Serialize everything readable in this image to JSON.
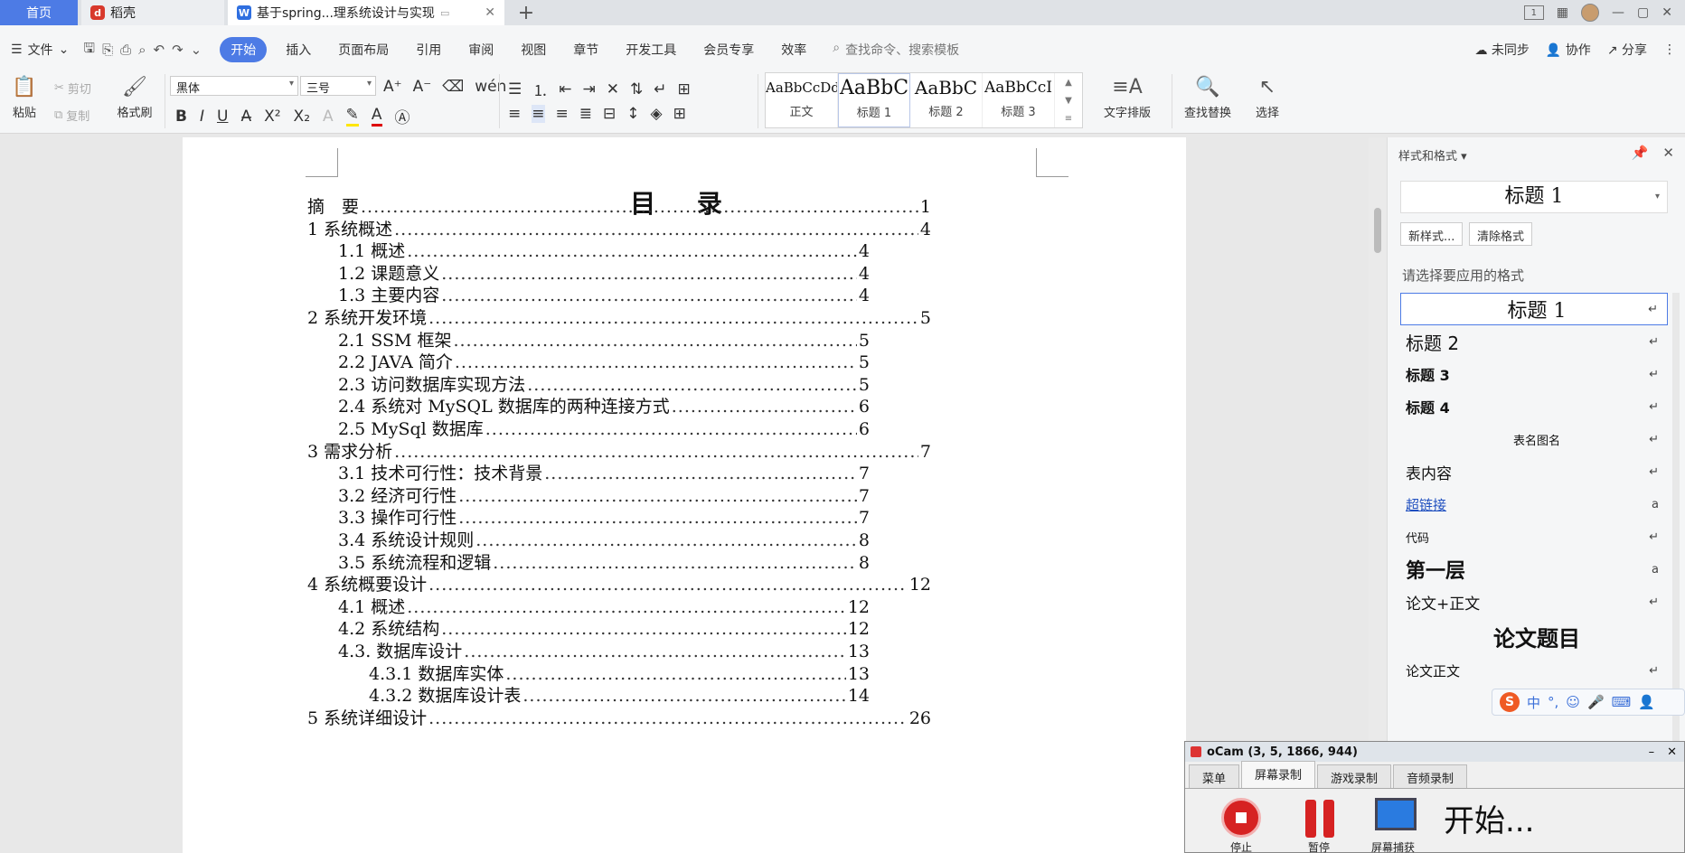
{
  "tabs": {
    "home": "首页",
    "docer": "稻壳",
    "doc": "基于spring...理系统设计与实现"
  },
  "window": {
    "page_indicator": "1"
  },
  "menu": {
    "file": "文件",
    "items": [
      "开始",
      "插入",
      "页面布局",
      "引用",
      "审阅",
      "视图",
      "章节",
      "开发工具",
      "会员专享",
      "效率"
    ],
    "search_placeholder": "查找命令、搜索模板",
    "sync": "未同步",
    "collab": "协作",
    "share": "分享"
  },
  "ribbon": {
    "paste": "粘贴",
    "cut": "剪切",
    "copy": "复制",
    "format_painter": "格式刷",
    "font_name": "黑体",
    "font_size": "三号",
    "styles": [
      {
        "sample": "AaBbCcDd",
        "name": "正文"
      },
      {
        "sample": "AaBbC",
        "name": "标题 1"
      },
      {
        "sample": "AaBbC",
        "name": "标题 2"
      },
      {
        "sample": "AaBbCcI",
        "name": "标题 3"
      }
    ],
    "text_layout": "文字排版",
    "find_replace": "查找替换",
    "select": "选择"
  },
  "document": {
    "toc_title": "目 录",
    "toc": [
      {
        "label": "摘　要",
        "page": "1",
        "level": 0
      },
      {
        "label": "1  系统概述",
        "page": "4",
        "level": 0
      },
      {
        "label": "1.1  概述",
        "page": "4",
        "level": 1
      },
      {
        "label": "1.2 课题意义",
        "page": "4",
        "level": 1
      },
      {
        "label": "1.3  主要内容",
        "page": "4",
        "level": 1
      },
      {
        "label": "2  系统开发环境",
        "page": "5",
        "level": 0
      },
      {
        "label": "2.1 SSM 框架",
        "page": "5",
        "level": 1
      },
      {
        "label": "2.2 JAVA 简介",
        "page": "5",
        "level": 1
      },
      {
        "label": "2.3 访问数据库实现方法",
        "page": "5",
        "level": 1
      },
      {
        "label": "2.4 系统对 MySQL 数据库的两种连接方式",
        "page": "6",
        "level": 1
      },
      {
        "label": "2.5 MySql 数据库",
        "page": "6",
        "level": 1
      },
      {
        "label": "3  需求分析",
        "page": "7",
        "level": 0
      },
      {
        "label": "3.1 技术可行性：技术背景",
        "page": "7",
        "level": 1
      },
      {
        "label": "3.2 经济可行性",
        "page": "7",
        "level": 1
      },
      {
        "label": "3.3 操作可行性",
        "page": "7",
        "level": 1
      },
      {
        "label": "3.4 系统设计规则",
        "page": "8",
        "level": 1
      },
      {
        "label": "3.5 系统流程和逻辑",
        "page": "8",
        "level": 1
      },
      {
        "label": "4 系统概要设计",
        "page": "12",
        "level": 0
      },
      {
        "label": "4.1  概述",
        "page": "12",
        "level": 1
      },
      {
        "label": "4.2  系统结构",
        "page": "12",
        "level": 1
      },
      {
        "label": "4.3.  数据库设计",
        "page": "13",
        "level": 1
      },
      {
        "label": "4.3.1  数据库实体",
        "page": "13",
        "level": 2
      },
      {
        "label": "4.3.2  数据库设计表",
        "page": "14",
        "level": 2
      },
      {
        "label": "5  系统详细设计",
        "page": "26",
        "level": 0
      }
    ]
  },
  "styles_panel": {
    "title": "样式和格式",
    "current": "标题  1",
    "new_style": "新样式...",
    "clear_format": "清除格式",
    "prompt": "请选择要应用的格式",
    "items": [
      {
        "name": "标题  1",
        "mark": "↵"
      },
      {
        "name": "标题  2",
        "mark": "↵"
      },
      {
        "name": "标题  3",
        "mark": "↵"
      },
      {
        "name": "标题  4",
        "mark": "↵"
      },
      {
        "name": "表名图名",
        "mark": "↵"
      },
      {
        "name": "表内容",
        "mark": "↵"
      },
      {
        "name": "超链接",
        "mark": "a"
      },
      {
        "name": "代码",
        "mark": "↵"
      },
      {
        "name": "第一层",
        "mark": "a"
      },
      {
        "name": "论文+正文",
        "mark": "↵"
      },
      {
        "name": "论文题目",
        "mark": ""
      },
      {
        "name": "论文正文",
        "mark": "↵"
      }
    ]
  },
  "ime": {
    "logo": "S",
    "mode": "中"
  },
  "ocam": {
    "title": "oCam (3, 5, 1866, 944)",
    "tabs": [
      "菜单",
      "屏幕录制",
      "游戏录制",
      "音频录制"
    ],
    "stop": "停止",
    "pause": "暂停",
    "screen": "屏幕捕获",
    "status": "开始..."
  }
}
